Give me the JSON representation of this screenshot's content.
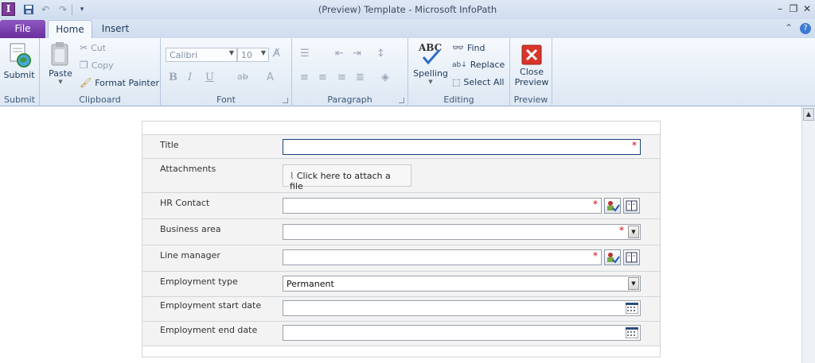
{
  "window": {
    "title": "(Preview) Template  -  Microsoft InfoPath",
    "app_icon_letter": "I"
  },
  "tabs": {
    "file": "File",
    "home": "Home",
    "insert": "Insert"
  },
  "ribbon": {
    "submit_group": {
      "button": "Submit",
      "label": "Submit"
    },
    "clipboard_group": {
      "paste": "Paste",
      "cut": "Cut",
      "copy": "Copy",
      "format_painter": "Format Painter",
      "label": "Clipboard"
    },
    "font_group": {
      "font_name": "Calibri",
      "font_size": "10",
      "label": "Font"
    },
    "paragraph_group": {
      "label": "Paragraph"
    },
    "editing_group": {
      "spelling": "Spelling",
      "find": "Find",
      "replace": "Replace",
      "select_all": "Select All",
      "label": "Editing"
    },
    "preview_group": {
      "close_preview_line1": "Close",
      "close_preview_line2": "Preview",
      "label": "Preview"
    }
  },
  "form": {
    "title_label": "Title",
    "attachments_label": "Attachments",
    "attach_button": "Click here to attach a file",
    "hr_contact_label": "HR Contact",
    "business_area_label": "Business area",
    "line_manager_label": "Line manager",
    "employment_type_label": "Employment type",
    "employment_type_value": "Permanent",
    "start_date_label": "Employment start date",
    "end_date_label": "Employment end date",
    "required_marker": "*"
  },
  "colors": {
    "file_tab": "#6a2f9e",
    "required": "#dd0000",
    "focus_border": "#1d3f78"
  }
}
